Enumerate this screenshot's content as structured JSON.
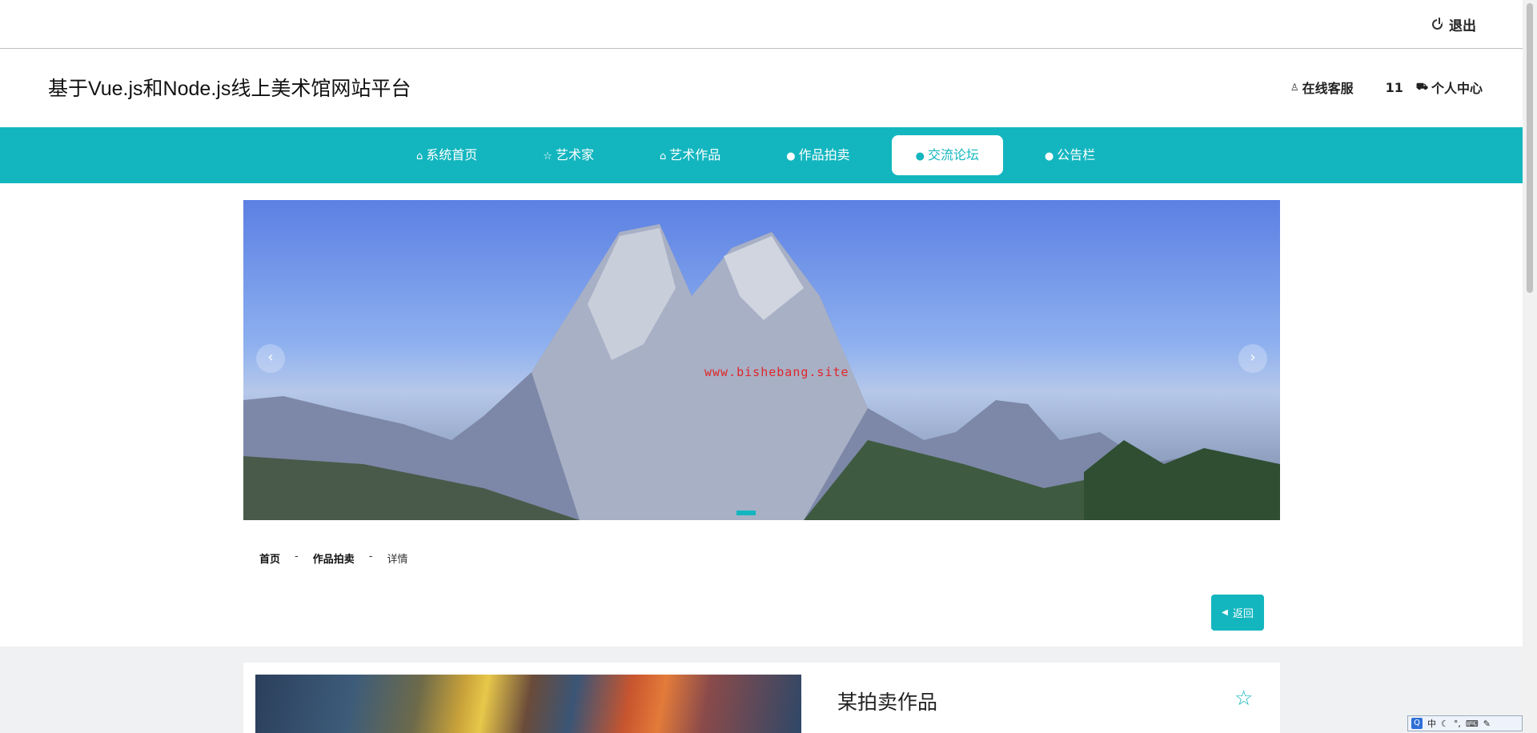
{
  "topbar": {
    "logout_label": "退出"
  },
  "header": {
    "site_title": "基于Vue.js和Node.js线上美术馆网站平台",
    "customer_service": "在线客服",
    "cart_count": "11",
    "user_center": "个人中心"
  },
  "nav": {
    "items": [
      {
        "label": "系统首页",
        "icon": "home-icon"
      },
      {
        "label": "艺术家",
        "icon": "star-icon"
      },
      {
        "label": "艺术作品",
        "icon": "bag-icon"
      },
      {
        "label": "作品拍卖",
        "icon": "info-icon"
      },
      {
        "label": "交流论坛",
        "icon": "question-icon",
        "active": true
      },
      {
        "label": "公告栏",
        "icon": "info-icon"
      }
    ]
  },
  "banner": {
    "watermark": "www.bishebang.site",
    "prev": "‹",
    "next": "›"
  },
  "breadcrumb": {
    "home": "首页",
    "sep": "-",
    "section": "作品拍卖",
    "current": "详情"
  },
  "back_button": {
    "label": "返回"
  },
  "detail": {
    "title": "某拍卖作品"
  },
  "colors": {
    "accent": "#13b6bf"
  }
}
